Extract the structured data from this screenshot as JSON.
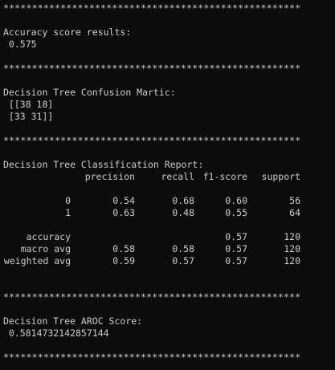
{
  "separator": "****************************************************",
  "accuracy": {
    "heading": "Accuracy score results:",
    "value": " 0.575"
  },
  "confusion": {
    "heading": "Decision Tree Confusion Martic:",
    "rows": [
      " [[38 18]",
      " [33 31]]"
    ]
  },
  "report": {
    "heading": "Decision Tree Classification Report:",
    "columns": [
      "precision",
      "recall",
      "f1-score",
      "support"
    ],
    "class_rows": [
      {
        "label": "0",
        "precision": "0.54",
        "recall": "0.68",
        "f1": "0.60",
        "support": "56"
      },
      {
        "label": "1",
        "precision": "0.63",
        "recall": "0.48",
        "f1": "0.55",
        "support": "64"
      }
    ],
    "summary_rows": [
      {
        "label": "accuracy",
        "precision": "",
        "recall": "",
        "f1": "0.57",
        "support": "120"
      },
      {
        "label": "macro avg",
        "precision": "0.58",
        "recall": "0.58",
        "f1": "0.57",
        "support": "120"
      },
      {
        "label": "weighted avg",
        "precision": "0.59",
        "recall": "0.57",
        "f1": "0.57",
        "support": "120"
      }
    ]
  },
  "aroc": {
    "heading": "Decision Tree AROC Score:",
    "value": " 0.5814732142857144"
  },
  "colors": {
    "background": "#0c0c0c",
    "text": "#cccccc"
  }
}
